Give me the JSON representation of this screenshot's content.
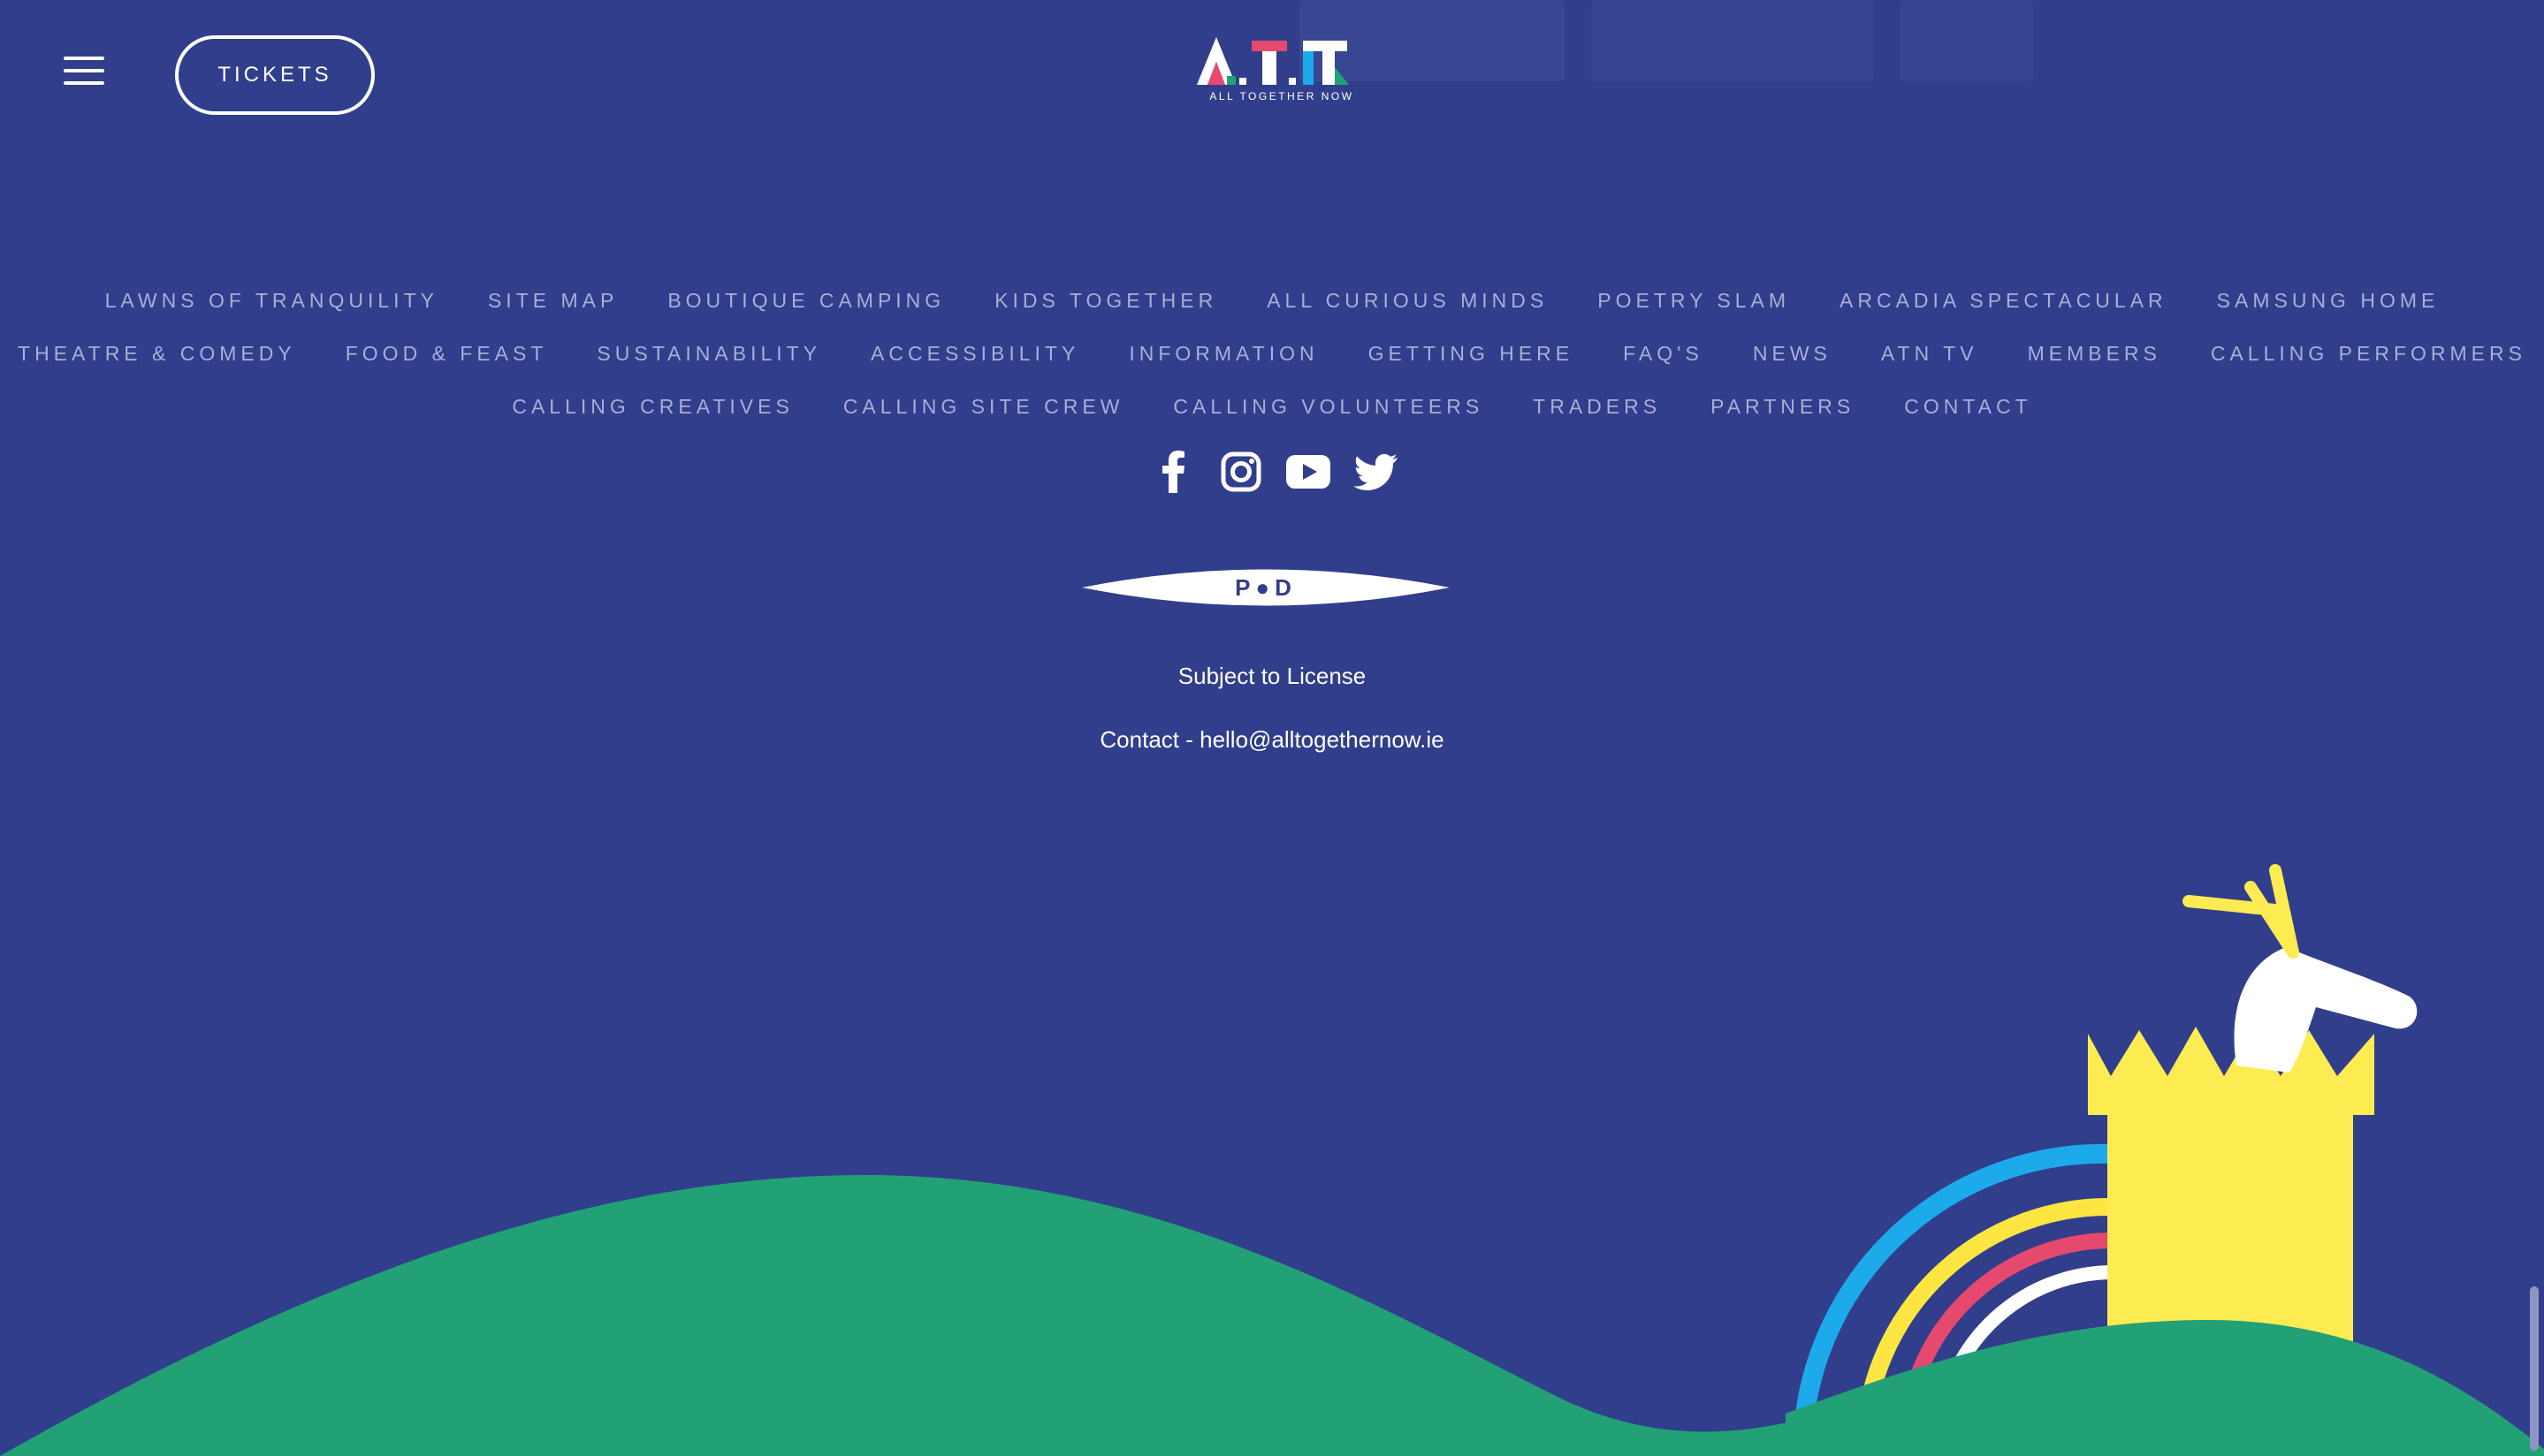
{
  "header": {
    "menu_icon": "hamburger-menu-icon",
    "tickets_label": "TICKETS",
    "logo_text": "ALL TOGETHER NOW"
  },
  "footer_nav": {
    "rows": [
      [
        "LAWNS OF TRANQUILITY",
        "SITE MAP",
        "BOUTIQUE CAMPING",
        "KIDS TOGETHER",
        "ALL CURIOUS MINDS",
        "POETRY SLAM",
        "ARCADIA SPECTACULAR",
        "SAMSUNG HOME"
      ],
      [
        "THEATRE & COMEDY",
        "FOOD & FEAST",
        "SUSTAINABILITY",
        "ACCESSIBILITY",
        "INFORMATION",
        "GETTING HERE",
        "FAQ'S",
        "NEWS",
        "ATN TV",
        "MEMBERS",
        "CALLING PERFORMERS"
      ],
      [
        "CALLING CREATIVES",
        "CALLING SITE CREW",
        "CALLING VOLUNTEERS",
        "TRADERS",
        "PARTNERS",
        "CONTACT"
      ]
    ]
  },
  "social": [
    "facebook-icon",
    "instagram-icon",
    "youtube-icon",
    "twitter-icon"
  ],
  "pod_badge": "P●D",
  "license_text": "Subject to License",
  "contact_text": "Contact - hello@alltogethernow.ie",
  "colors": {
    "background": "#313e8b",
    "nav_link": "#a7aed8",
    "hill_green": "#22a176",
    "castle_yellow": "#fdeb52",
    "rainbow_blue": "#1daaeb",
    "rainbow_yellow": "#fde642",
    "rainbow_red": "#e6496e",
    "rainbow_white": "#ffffff"
  }
}
